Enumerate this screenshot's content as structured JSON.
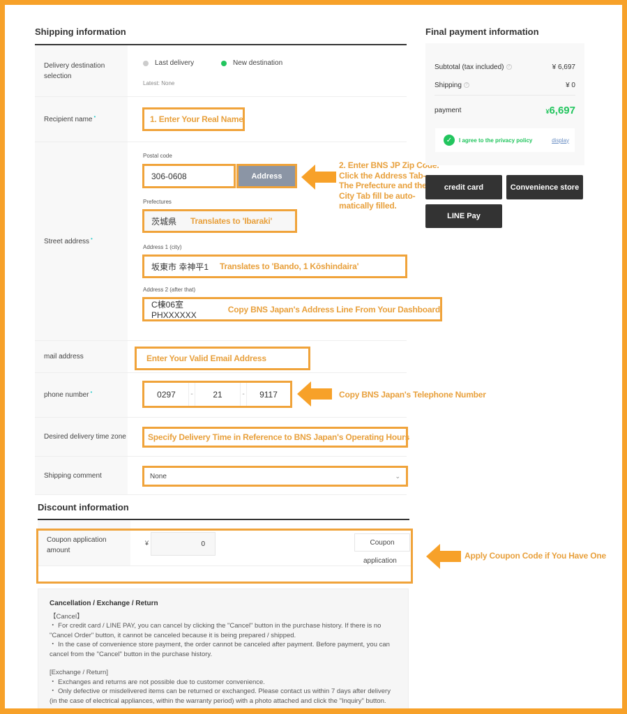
{
  "shipping": {
    "title": "Shipping information",
    "delivery_selection": {
      "label": "Delivery destination selection",
      "options": [
        {
          "label": "Last delivery",
          "selected": false
        },
        {
          "label": "New destination",
          "selected": true
        }
      ],
      "latest": "Latest: None"
    },
    "recipient": {
      "label": "Recipient name",
      "annotation": "1. Enter Your Real Name"
    },
    "street_address": {
      "label": "Street address",
      "postal_label": "Postal code",
      "postal_value": "306-0608",
      "address_button": "Address",
      "prefecture_label": "Prefectures",
      "prefecture_value": "茨城県",
      "prefecture_annotation": "Translates to 'Ibaraki'",
      "address1_label": "Address 1 (city)",
      "address1_value": "坂東市 幸神平1",
      "address1_annotation": "Translates to 'Bando, 1 Kōshindaira'",
      "address2_label": "Address 2 (after that)",
      "address2_value": "C棟06室 PHXXXXXX",
      "address2_annotation": "Copy BNS Japan's Address Line From Your Dashboard",
      "side_annotation": [
        "2. Enter BNS JP Zip Code.",
        "Click the Address Tab-",
        "The Prefecture and the",
        "City Tab fill be auto-",
        "matically filled."
      ]
    },
    "mail": {
      "label": "mail address",
      "annotation": "Enter Your Valid Email Address"
    },
    "phone": {
      "label": "phone number",
      "parts": [
        "0297",
        "21",
        "9117"
      ],
      "separator": "-",
      "annotation": "Copy BNS Japan's Telephone Number"
    },
    "delivery_time": {
      "label": "Desired delivery time zone",
      "annotation": "Specify Delivery Time in Reference to BNS Japan's Operating Hours"
    },
    "comment": {
      "label": "Shipping comment",
      "value": "None"
    }
  },
  "discount": {
    "title": "Discount information",
    "coupon_label": "Coupon application amount",
    "currency": "¥",
    "coupon_value": "0",
    "coupon_button_line1": "Coupon",
    "coupon_button_line2": "application",
    "annotation": "Apply Coupon Code if You Have One"
  },
  "payment": {
    "title": "Final payment information",
    "subtotal_label": "Subtotal (tax included)",
    "subtotal_value": "¥ 6,697",
    "shipping_label": "Shipping",
    "shipping_value": "¥ 0",
    "payment_label": "payment",
    "payment_currency": "¥",
    "payment_value": "6,697",
    "privacy_text": "I agree to the privacy policy",
    "privacy_link": "display",
    "methods": [
      "credit card",
      "Convenience store",
      "LINE Pay"
    ]
  },
  "policy": {
    "title": "Cancellation / Exchange / Return",
    "cancel_heading": "【Cancel】",
    "cancel_items": [
      "・ For credit card / LINE PAY, you can cancel by clicking the \"Cancel\" button in the purchase history. If there is no \"Cancel Order\" button, it cannot be canceled because it is being prepared / shipped.",
      "・ In the case of convenience store payment, the order cannot be canceled after payment. Before payment, you can cancel from the \"Cancel\" button in the purchase history."
    ],
    "exchange_heading": "[Exchange / Return]",
    "exchange_items": [
      "・ Exchanges and returns are not possible due to customer convenience.",
      "・ Only defective or misdelivered items can be returned or exchanged. Please contact us within 7 days after delivery (in the case of electrical appliances, within the warranty period) with a photo attached and click the \"Inquiry\" button."
    ]
  },
  "colors": {
    "annotation_orange": "#f0a33a",
    "frame_orange": "#f7a129",
    "accent_green": "#22c55e",
    "button_dark": "#333333",
    "address_button_gray": "#8b95a5"
  }
}
